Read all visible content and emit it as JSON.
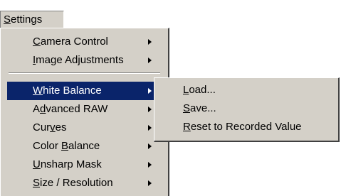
{
  "menubar": {
    "title_u": "S",
    "title_rest": "ettings"
  },
  "dropdown": {
    "items": [
      {
        "u": "C",
        "rest": "amera Control",
        "pre": ""
      },
      {
        "u": "I",
        "rest": "mage Adjustments",
        "pre": ""
      },
      {
        "u": "W",
        "rest": "hite Balance",
        "pre": ""
      },
      {
        "pre": "A",
        "u": "d",
        "rest": "vanced RAW"
      },
      {
        "pre": "Cur",
        "u": "v",
        "rest": "es"
      },
      {
        "pre": "Color ",
        "u": "B",
        "rest": "alance"
      },
      {
        "pre": "",
        "u": "U",
        "rest": "nsharp Mask"
      },
      {
        "pre": "",
        "u": "S",
        "rest": "ize / Resolution"
      }
    ]
  },
  "submenu": {
    "items": [
      {
        "u": "L",
        "rest": "oad..."
      },
      {
        "u": "S",
        "rest": "ave..."
      },
      {
        "u": "R",
        "rest": "eset to Recorded Value"
      }
    ]
  },
  "colors": {
    "menu_bg": "#d4d0c8",
    "highlight": "#0a246a",
    "highlight_text": "#ffffff"
  }
}
